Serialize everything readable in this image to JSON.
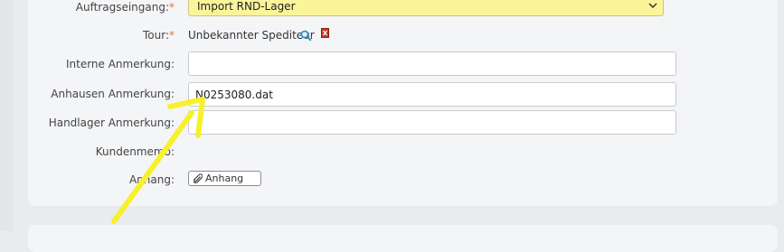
{
  "form": {
    "order_entry": {
      "label": "Auftragseingang:",
      "required_mark": "*",
      "selected": "Import RND-Lager"
    },
    "tour": {
      "label": "Tour:",
      "required_mark": "*",
      "value": "Unbekannter Spediteur"
    },
    "internal_note": {
      "label": "Interne Anmerkung:",
      "value": ""
    },
    "anhausen_note": {
      "label": "Anhausen Anmerkung:",
      "value": "N0253080.dat"
    },
    "handlager_note": {
      "label": "Handlager Anmerkung:",
      "value": ""
    },
    "customer_memo": {
      "label": "Kundenmemo:"
    },
    "attachment": {
      "label": "Anhang:",
      "button_label": "Anhang"
    }
  },
  "icons": {
    "search": "search-icon",
    "delete": "delete-icon",
    "paperclip": "paperclip-icon",
    "chevron": "chevron-down-icon"
  },
  "colors": {
    "select_bg": "#fbf59a",
    "required": "#e8742c",
    "arrow": "#f6f12a",
    "delete": "#c0392b"
  }
}
